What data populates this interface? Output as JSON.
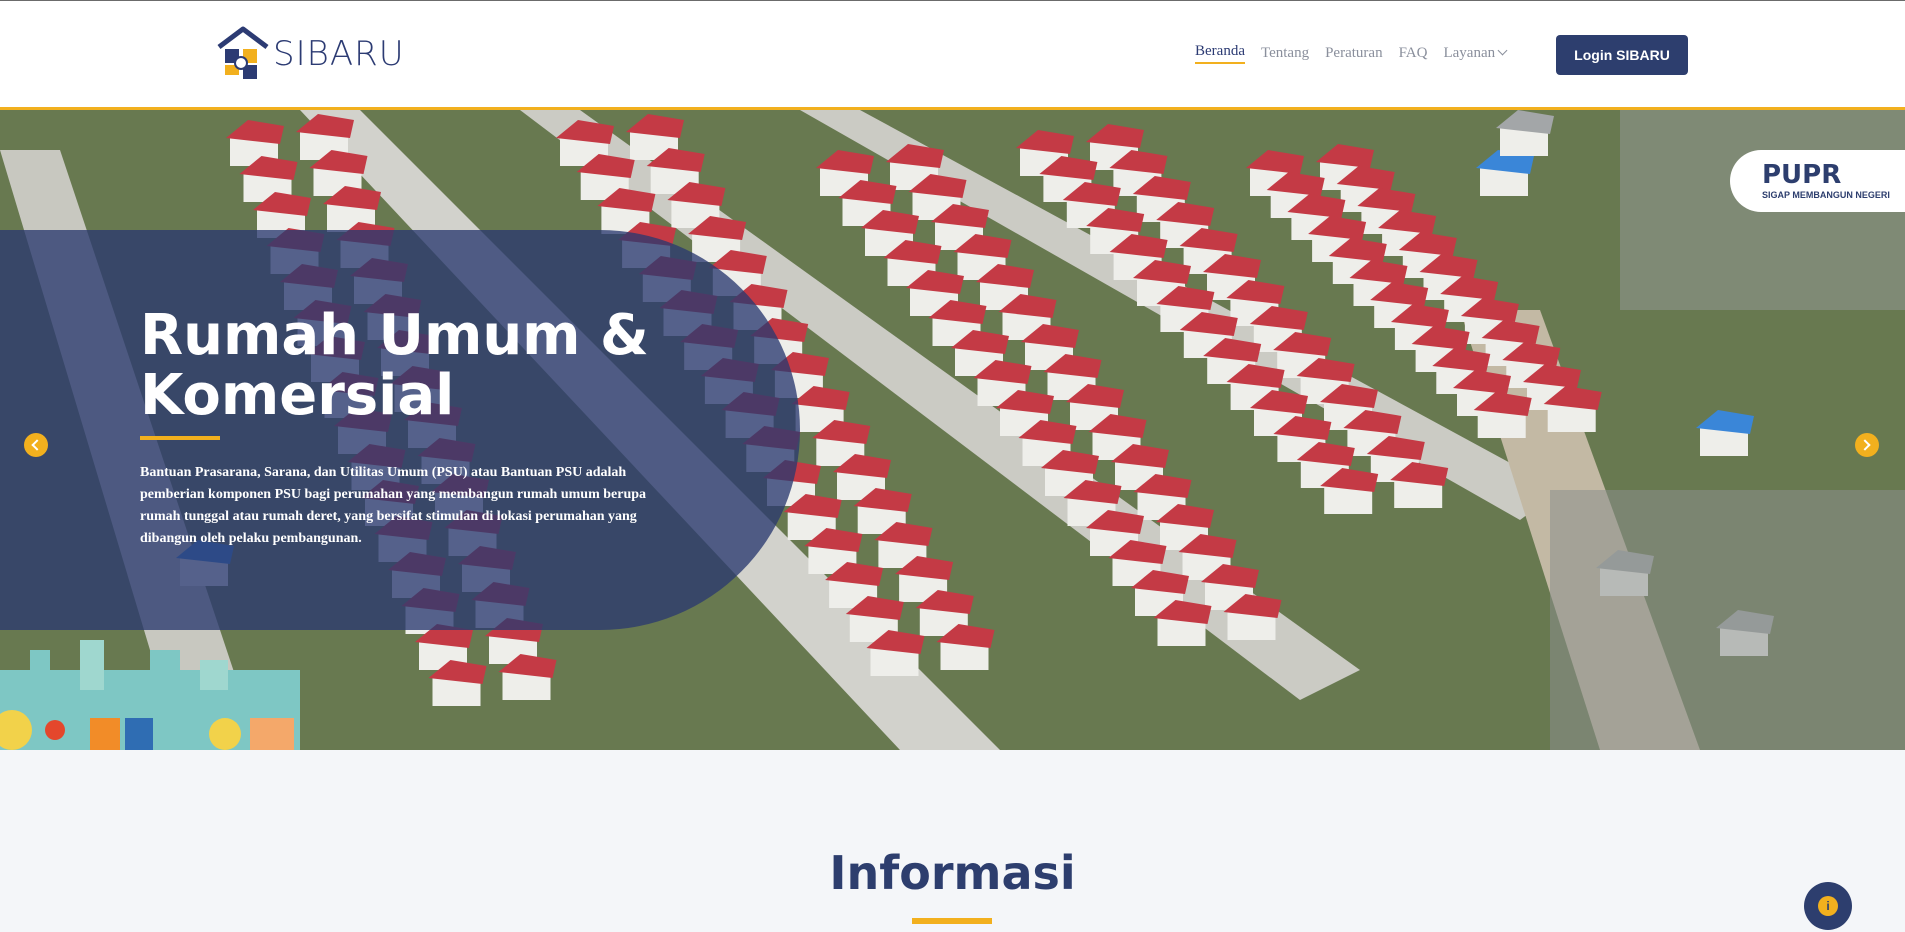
{
  "brand": {
    "name": "SIBARU",
    "logo_icon": "house-logo-icon"
  },
  "nav": {
    "items": [
      "Beranda",
      "Tentang",
      "Peraturan",
      "FAQ",
      "Layanan"
    ],
    "active": "Beranda"
  },
  "login_label": "Login SIBARU",
  "hero": {
    "title": "Rumah Umum & Komersial",
    "description": "Bantuan Prasarana, Sarana, dan Utilitas Umum (PSU) atau Bantuan PSU adalah pemberian komponen PSU bagi perumahan yang membangun rumah umum berupa rumah tunggal atau rumah deret, yang bersifat stimulan di lokasi perumahan yang dibangun oleh pelaku pembangunan.",
    "badge_title": "PUPR",
    "badge_subtitle": "SIGAP MEMBANGUN NEGERI"
  },
  "section": {
    "title": "Informasi"
  },
  "colors": {
    "primary": "#2d3e6e",
    "accent": "#f2b01e",
    "background": "#f4f6f9"
  },
  "icons": {
    "prev": "chevron-left-icon",
    "next": "chevron-right-icon",
    "chat": "chat-icon"
  }
}
